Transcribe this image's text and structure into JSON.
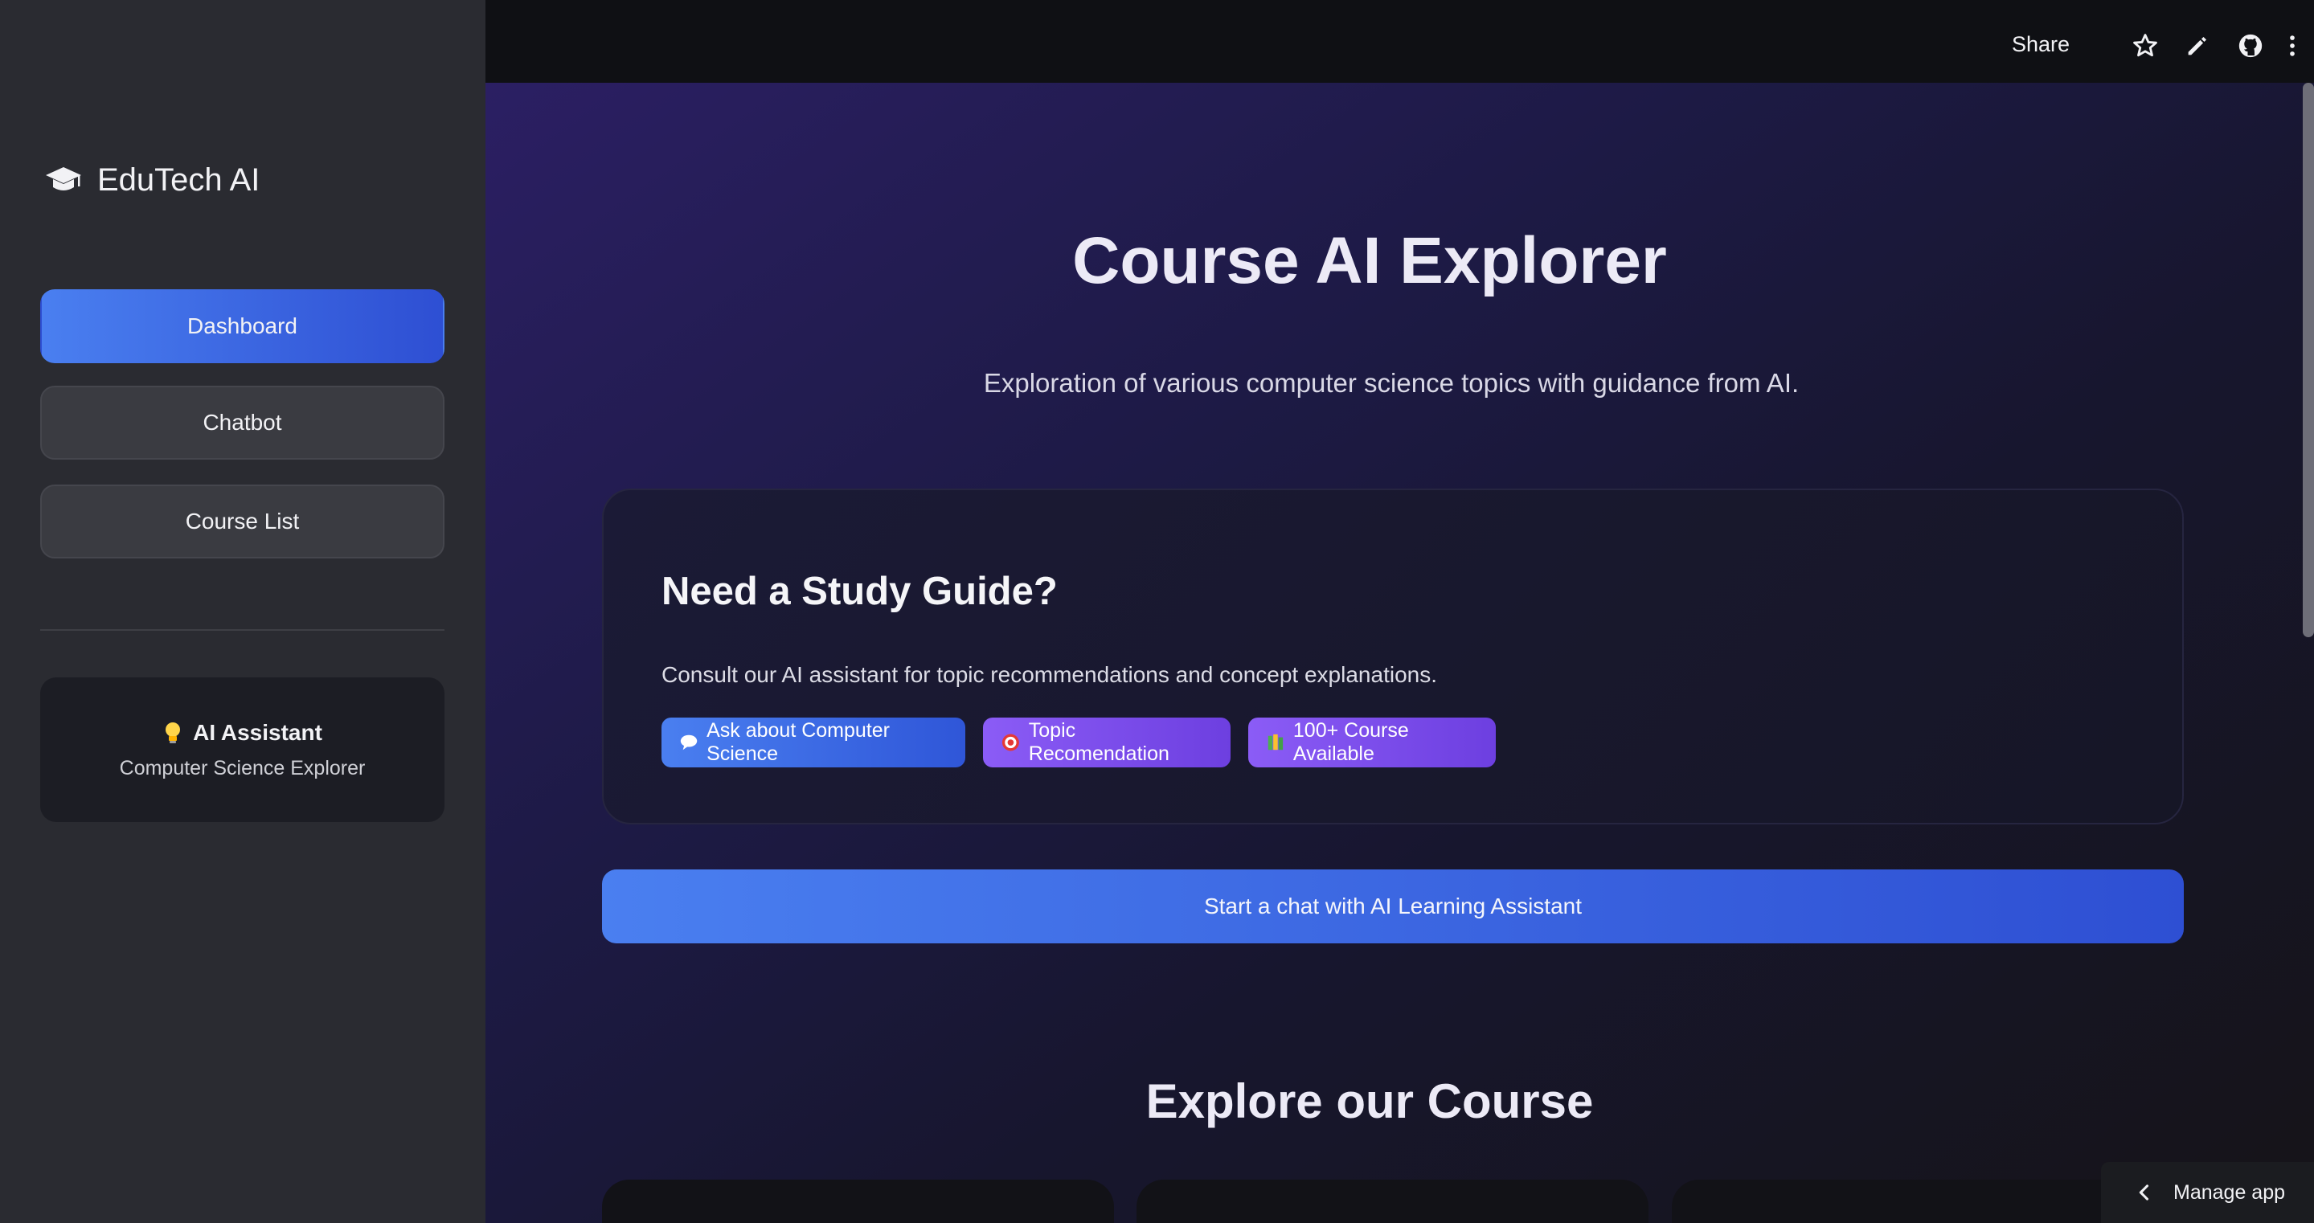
{
  "sidebar": {
    "brand": "EduTech AI",
    "nav": [
      "Dashboard",
      "Chatbot",
      "Course List"
    ],
    "assistant": {
      "title": "AI Assistant",
      "subtitle": "Computer Science Explorer"
    }
  },
  "topbar": {
    "share": "Share",
    "icons": [
      "star-icon",
      "pencil-icon",
      "github-icon",
      "more-vertical-icon"
    ]
  },
  "main": {
    "title": "Course AI Explorer",
    "subtitle": "Exploration of various computer science topics with guidance from AI.",
    "guide": {
      "title": "Need a Study Guide?",
      "description": "Consult our AI assistant for topic recommendations and concept explanations.",
      "chips": [
        "Ask about Computer Science",
        "Topic Recomendation",
        "100+ Course Available"
      ]
    },
    "chat_button": "Start a chat with AI Learning Assistant",
    "section_title": "Explore our Course"
  },
  "manage_app": "Manage app",
  "colors": {
    "accent_blue": "#4a7ff0",
    "accent_purple": "#8b5cf6",
    "sidebar_bg": "#2a2b31"
  }
}
